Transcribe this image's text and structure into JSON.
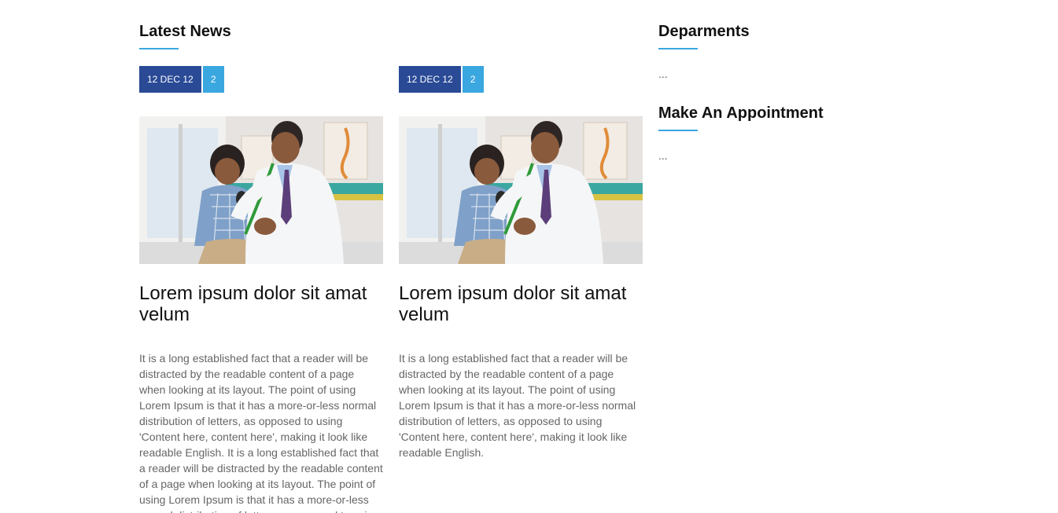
{
  "latest_news": {
    "heading": "Latest News",
    "cards": [
      {
        "date": "12 DEC 12",
        "comments": "2",
        "title": "Lorem ipsum dolor sit amat velum",
        "body": "It is a long established fact that a reader will be distracted by the readable content of a page when looking at its layout. The point of using Lorem Ipsum is that it has a more-or-less normal distribution of letters, as opposed to using 'Content here, content here', making it look like readable English. It is a long established fact that a reader will be distracted by the readable content of a page when looking at its layout. The point of using Lorem Ipsum is that it has a more-or-less normal distribution of letters, as opposed to using"
      },
      {
        "date": "12 DEC 12",
        "comments": "2",
        "title": "Lorem ipsum dolor sit amat velum",
        "body": "It is a long established fact that a reader will be distracted by the readable content of a page when looking at its layout. The point of using Lorem Ipsum is that it has a more-or-less normal distribution of letters, as opposed to using 'Content here, content here', making it look like readable English."
      }
    ]
  },
  "departments": {
    "heading": "Deparments",
    "content": "..."
  },
  "appointment": {
    "heading": "Make An Appointment",
    "content": "..."
  },
  "colors": {
    "accent": "#3aa7e0",
    "date_badge": "#2a4a96",
    "body_text": "#666666",
    "heading_text": "#111111"
  },
  "icons": {
    "photo": "doctor-examining-child-photo"
  }
}
